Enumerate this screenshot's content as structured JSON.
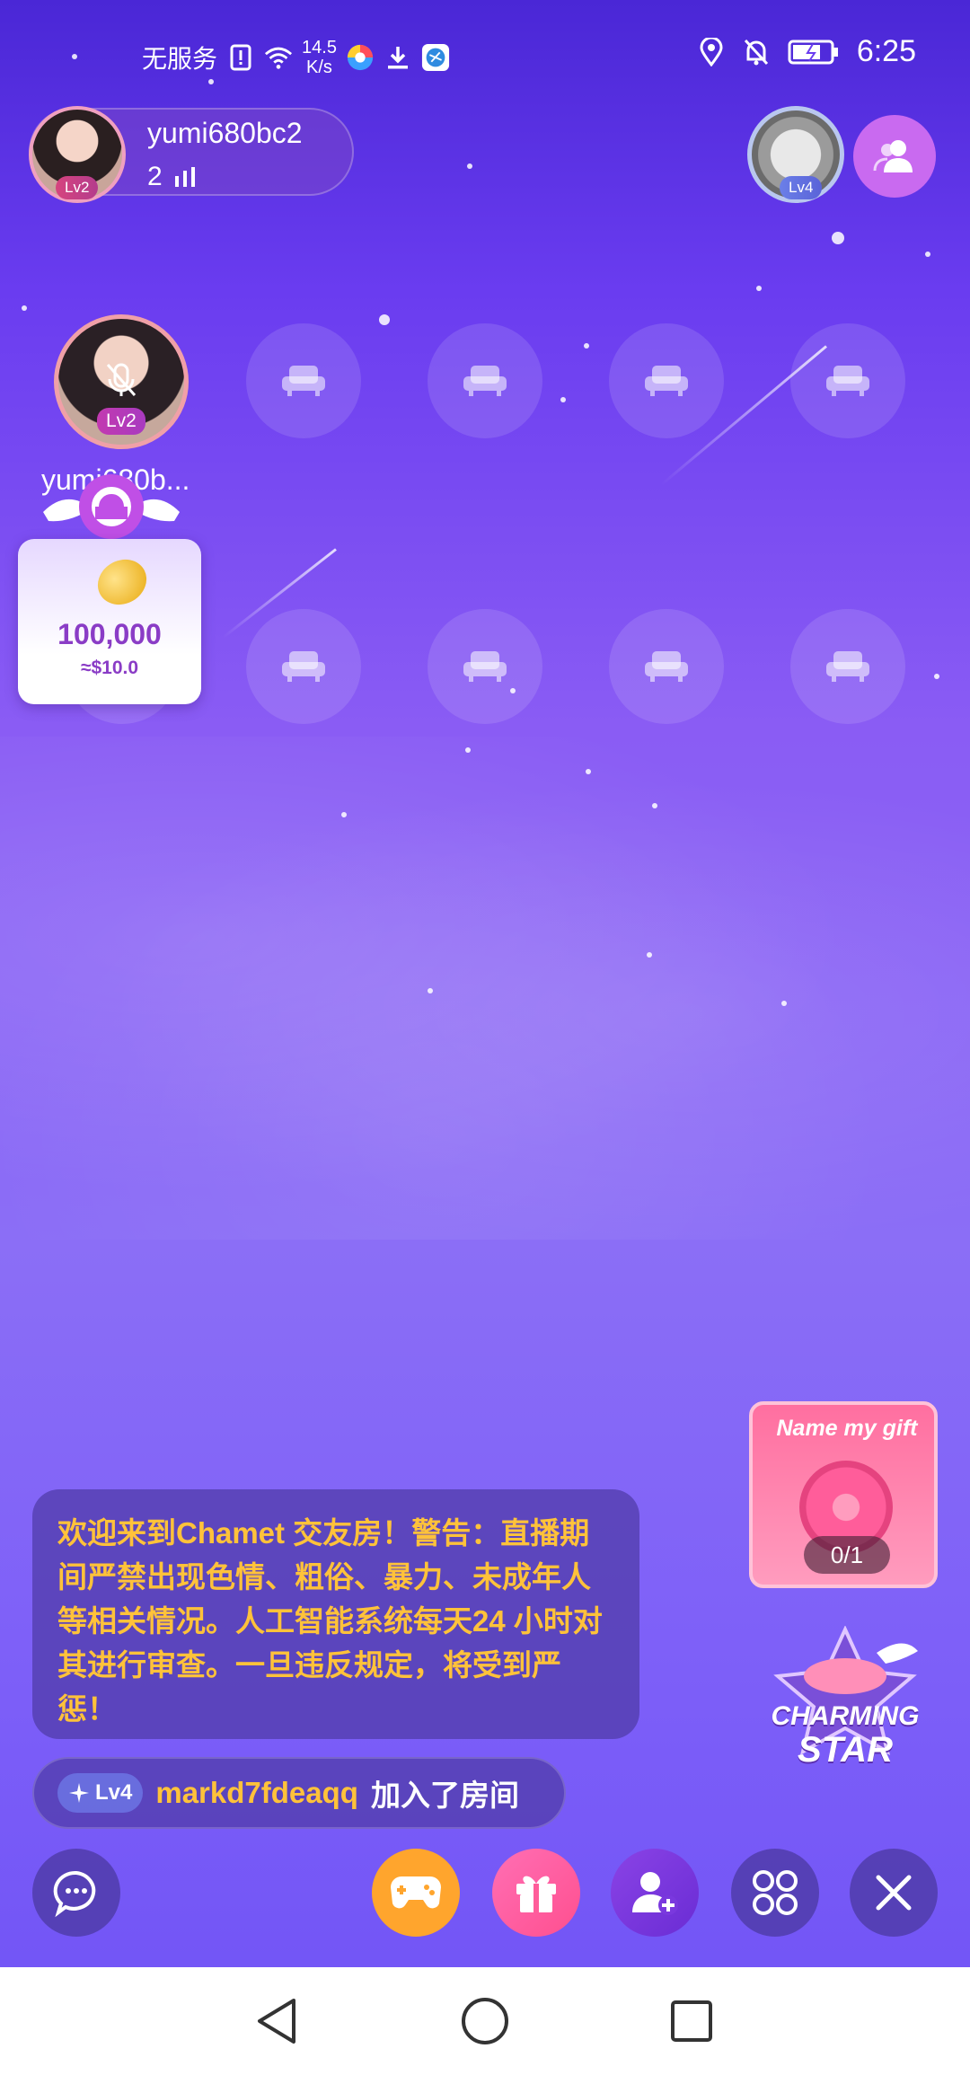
{
  "status_bar": {
    "carrier": "无服务",
    "speed_value": "14.5",
    "speed_unit": "K/s",
    "time": "6:25"
  },
  "host": {
    "name": "yumi680bc2",
    "level": "Lv2",
    "audience_count": "2"
  },
  "top_right": {
    "level": "Lv4"
  },
  "seat_owner": {
    "name": "yumi680b...",
    "level": "Lv2"
  },
  "coin_card": {
    "amount": "100,000",
    "usd": "≈$10.0"
  },
  "notice": {
    "text": "欢迎来到Chamet 交友房！警告：直播期间严禁出现色情、粗俗、暴力、未成年人等相关情况。人工智能系统每天24 小时对其进行审查。一旦违反规定，将受到严惩！"
  },
  "join_message": {
    "level": "Lv4",
    "user": "markd7fdeaqq",
    "action": "加入了房间"
  },
  "gift_promo": {
    "title": "Name my gift",
    "count": "0/1"
  },
  "charming_star": {
    "line1": "CHARMING",
    "line2": "STAR"
  },
  "colors": {
    "accent_gold": "#ffc23a",
    "coin_purple": "#8a3cc6"
  },
  "toolbar": {
    "items": [
      "chat-icon",
      "game-icon",
      "gift-icon",
      "add-user-icon",
      "apps-icon",
      "close-icon"
    ]
  }
}
